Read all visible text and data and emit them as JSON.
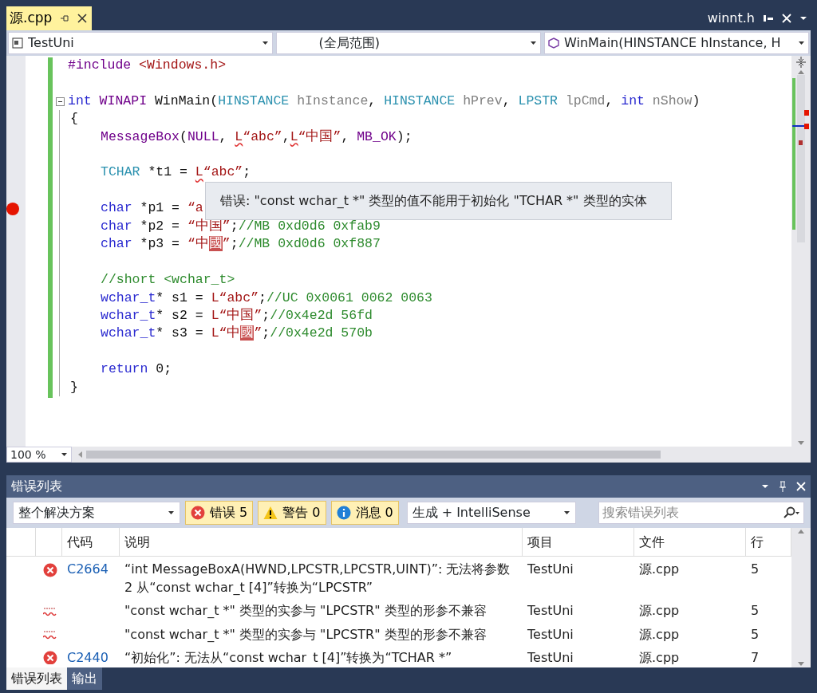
{
  "doc_tabs": [
    {
      "label": "源.cpp",
      "selected": true
    }
  ],
  "right_tab": {
    "label": "winnt.h"
  },
  "nav_bar": [
    {
      "kind": "project",
      "text": "TestUni"
    },
    {
      "kind": "scope",
      "text": "(全局范围)"
    },
    {
      "kind": "member",
      "text": "WinMain(HINSTANCE hInstance, H"
    }
  ],
  "code_lines": [
    {
      "kind": "code",
      "breakpoint": false,
      "segments": [
        {
          "kind": "macro",
          "text": "#include"
        },
        {
          "kind": "str",
          "text": " <Windows.h>"
        }
      ]
    },
    {
      "kind": "blank"
    },
    {
      "kind": "code",
      "breakpoint": false,
      "collapsible": true,
      "segments": [
        {
          "kind": "kw",
          "text": "int"
        },
        {
          "kind": "macro",
          "text": " WINAPI"
        },
        {
          "kind": "plain",
          "text": " WinMain("
        },
        {
          "kind": "type",
          "text": "HINSTANCE"
        },
        {
          "kind": "param",
          "text": " hInstance"
        },
        {
          "kind": "plain",
          "text": ", "
        },
        {
          "kind": "type",
          "text": "HINSTANCE"
        },
        {
          "kind": "param",
          "text": " hPrev"
        },
        {
          "kind": "plain",
          "text": ", "
        },
        {
          "kind": "type",
          "text": "LPSTR"
        },
        {
          "kind": "param",
          "text": " lpCmd"
        },
        {
          "kind": "plain",
          "text": ", "
        },
        {
          "kind": "kw",
          "text": "int"
        },
        {
          "kind": "param",
          "text": " nShow"
        },
        {
          "kind": "plain",
          "text": ")"
        }
      ],
      "children": [
        {
          "kind": "code",
          "breakpoint": false,
          "segments": [
            {
              "kind": "plain",
              "text": "{"
            }
          ],
          "children": [
            {
              "kind": "code",
              "breakpoint": false,
              "segments": [
                {
                  "kind": "macro",
                  "text": "MessageBox"
                },
                {
                  "kind": "plain",
                  "text": "("
                },
                {
                  "kind": "macro",
                  "text": "NULL"
                },
                {
                  "kind": "plain",
                  "text": ", "
                },
                {
                  "kind": "strerr",
                  "text": "L"
                },
                {
                  "kind": "str",
                  "text": "“abc”"
                },
                {
                  "kind": "plain",
                  "text": ","
                },
                {
                  "kind": "strerr",
                  "text": "L"
                },
                {
                  "kind": "str",
                  "text": "“中国”"
                },
                {
                  "kind": "plain",
                  "text": ", "
                },
                {
                  "kind": "macro",
                  "text": "MB_OK"
                },
                {
                  "kind": "plain",
                  "text": ");"
                }
              ]
            },
            {
              "kind": "blank"
            },
            {
              "kind": "code",
              "breakpoint": false,
              "segments": [
                {
                  "kind": "type",
                  "text": "TCHAR"
                },
                {
                  "kind": "plain",
                  "text": " *t1 = "
                },
                {
                  "kind": "strerr",
                  "text": "L"
                },
                {
                  "kind": "str",
                  "text": "“abc”"
                },
                {
                  "kind": "plain",
                  "text": ";"
                }
              ]
            },
            {
              "kind": "blank"
            },
            {
              "kind": "code",
              "breakpoint": true,
              "segments": [
                {
                  "kind": "kw",
                  "text": "char"
                },
                {
                  "kind": "plain",
                  "text": " *p1 = "
                },
                {
                  "kind": "str",
                  "text": "“a"
                }
              ]
            },
            {
              "kind": "code",
              "breakpoint": false,
              "segments": [
                {
                  "kind": "kw",
                  "text": "char"
                },
                {
                  "kind": "plain",
                  "text": " *p2 = "
                },
                {
                  "kind": "str",
                  "text": "“中国”"
                },
                {
                  "kind": "plain",
                  "text": ";"
                },
                {
                  "kind": "comment",
                  "text": "//MB 0xd0d6 0xfab9"
                }
              ]
            },
            {
              "kind": "code",
              "breakpoint": false,
              "segments": [
                {
                  "kind": "kw",
                  "text": "char"
                },
                {
                  "kind": "plain",
                  "text": " *p3 = "
                },
                {
                  "kind": "str",
                  "text": "“中"
                },
                {
                  "kind": "missing",
                  "text": "國"
                },
                {
                  "kind": "str",
                  "text": "”"
                },
                {
                  "kind": "plain",
                  "text": ";"
                },
                {
                  "kind": "comment",
                  "text": "//MB 0xd0d6 0xf887"
                }
              ]
            },
            {
              "kind": "blank"
            },
            {
              "kind": "code",
              "breakpoint": false,
              "segments": [
                {
                  "kind": "comment",
                  "text": "//short <wchar_t>"
                }
              ]
            },
            {
              "kind": "code",
              "breakpoint": false,
              "segments": [
                {
                  "kind": "kw",
                  "text": "wchar_t"
                },
                {
                  "kind": "plain",
                  "text": "* s1 = "
                },
                {
                  "kind": "str",
                  "text": "L“abc”"
                },
                {
                  "kind": "plain",
                  "text": ";"
                },
                {
                  "kind": "comment",
                  "text": "//UC 0x0061 0062 0063"
                }
              ]
            },
            {
              "kind": "code",
              "breakpoint": false,
              "segments": [
                {
                  "kind": "kw",
                  "text": "wchar_t"
                },
                {
                  "kind": "plain",
                  "text": "* s2 = "
                },
                {
                  "kind": "str",
                  "text": "L“中国”"
                },
                {
                  "kind": "plain",
                  "text": ";"
                },
                {
                  "kind": "comment",
                  "text": "//0x4e2d 56fd"
                }
              ]
            },
            {
              "kind": "code",
              "breakpoint": false,
              "segments": [
                {
                  "kind": "kw",
                  "text": "wchar_t"
                },
                {
                  "kind": "plain",
                  "text": "* s3 = "
                },
                {
                  "kind": "str",
                  "text": "L“中"
                },
                {
                  "kind": "missing",
                  "text": "國"
                },
                {
                  "kind": "str",
                  "text": "”"
                },
                {
                  "kind": "plain",
                  "text": ";"
                },
                {
                  "kind": "comment",
                  "text": "//0x4e2d 570b"
                }
              ]
            },
            {
              "kind": "blank"
            },
            {
              "kind": "code",
              "breakpoint": false,
              "segments": [
                {
                  "kind": "kw",
                  "text": "return"
                },
                {
                  "kind": "plain",
                  "text": " 0;"
                }
              ]
            }
          ]
        },
        {
          "kind": "code",
          "breakpoint": false,
          "segments": [
            {
              "kind": "plain",
              "text": "}"
            }
          ]
        }
      ]
    }
  ],
  "tooltip": {
    "text": "错误: \"const wchar_t *\" 类型的值不能用于初始化 \"TCHAR *\" 类型的实体"
  },
  "zoom": {
    "value": "100 %"
  },
  "error_list": {
    "title": "错误列表",
    "scope": "整个解决方案",
    "filters": [
      {
        "kind": "error",
        "label": "错误 5",
        "selected": true
      },
      {
        "kind": "warning",
        "label": "警告 0",
        "selected": true
      },
      {
        "kind": "message",
        "label": "消息 0",
        "selected": true
      }
    ],
    "source": "生成 + IntelliSense",
    "search": {
      "placeholder": "搜索错误列表"
    },
    "columns": [
      "代码",
      "说明",
      "项目",
      "文件",
      "行"
    ],
    "rows": [
      {
        "kind": "error",
        "code": "C2664",
        "description": "“int MessageBoxA(HWND,LPCSTR,LPCSTR,UINT)”: 无法将参数 2 从“const wchar_t [4]”转换为“LPCSTR”",
        "project": "TestUni",
        "file": "源.cpp",
        "line": "5"
      },
      {
        "kind": "intellisense",
        "description": "\"const wchar_t *\" 类型的实参与 \"LPCSTR\" 类型的形参不兼容",
        "project": "TestUni",
        "file": "源.cpp",
        "line": "5"
      },
      {
        "kind": "intellisense",
        "description": "\"const wchar_t *\" 类型的实参与 \"LPCSTR\" 类型的形参不兼容",
        "project": "TestUni",
        "file": "源.cpp",
        "line": "5"
      },
      {
        "kind": "error",
        "code": "C2440",
        "description": "“初始化”: 无法从“const wchar_t [4]”转换为“TCHAR *”",
        "project": "TestUni",
        "file": "源.cpp",
        "line": "7"
      }
    ]
  },
  "bottom_tabs": [
    {
      "label": "错误列表",
      "selected": true
    },
    {
      "label": "输出",
      "selected": false
    }
  ]
}
